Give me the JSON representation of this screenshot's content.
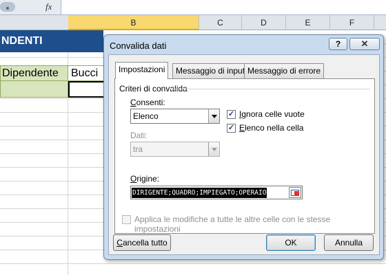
{
  "formula_bar": {
    "fx_label": "fx"
  },
  "sheet": {
    "columns": [
      "B",
      "C",
      "D",
      "E",
      "F"
    ],
    "title_text": "NDENTI",
    "cells": {
      "dipendente": "Dipendente",
      "bucci": "Bucci"
    }
  },
  "dialog": {
    "title": "Convalida dati",
    "help_label": "?",
    "close_label": "✕",
    "tabs": [
      {
        "label": "Impostazioni",
        "active": true
      },
      {
        "label": "Messaggio di input",
        "active": false
      },
      {
        "label": "Messaggio di errore",
        "active": false
      }
    ],
    "section_label": "Criteri di convalida",
    "consenti_label": "Consenti:",
    "consenti_value": "Elenco",
    "dati_label": "Dati:",
    "dati_value": "tra",
    "ignora_label": "Ignora celle vuote",
    "ignora_checked": true,
    "elenco_label": "Elenco nella cella",
    "elenco_checked": true,
    "origine_label": "Origine:",
    "origine_value": "DIRIGENTE;QUADRO;IMPIEGATO;OPERAIO",
    "applica_label": "Applica le modifiche a tutte le altre celle con le stesse impostazioni",
    "applica_checked": false,
    "cancella_label": "Cancella tutto",
    "ok_label": "OK",
    "annulla_label": "Annulla"
  },
  "colors": {
    "title_band": "#1f4e8c",
    "header_green": "#d8e4bc",
    "dialog_frame": "#c7daee",
    "selected_col": "#f8d86f"
  },
  "icons": [
    "fx-icon",
    "help-icon",
    "close-icon",
    "dropdown-arrow-icon",
    "range-select-icon",
    "checkmark-icon"
  ]
}
